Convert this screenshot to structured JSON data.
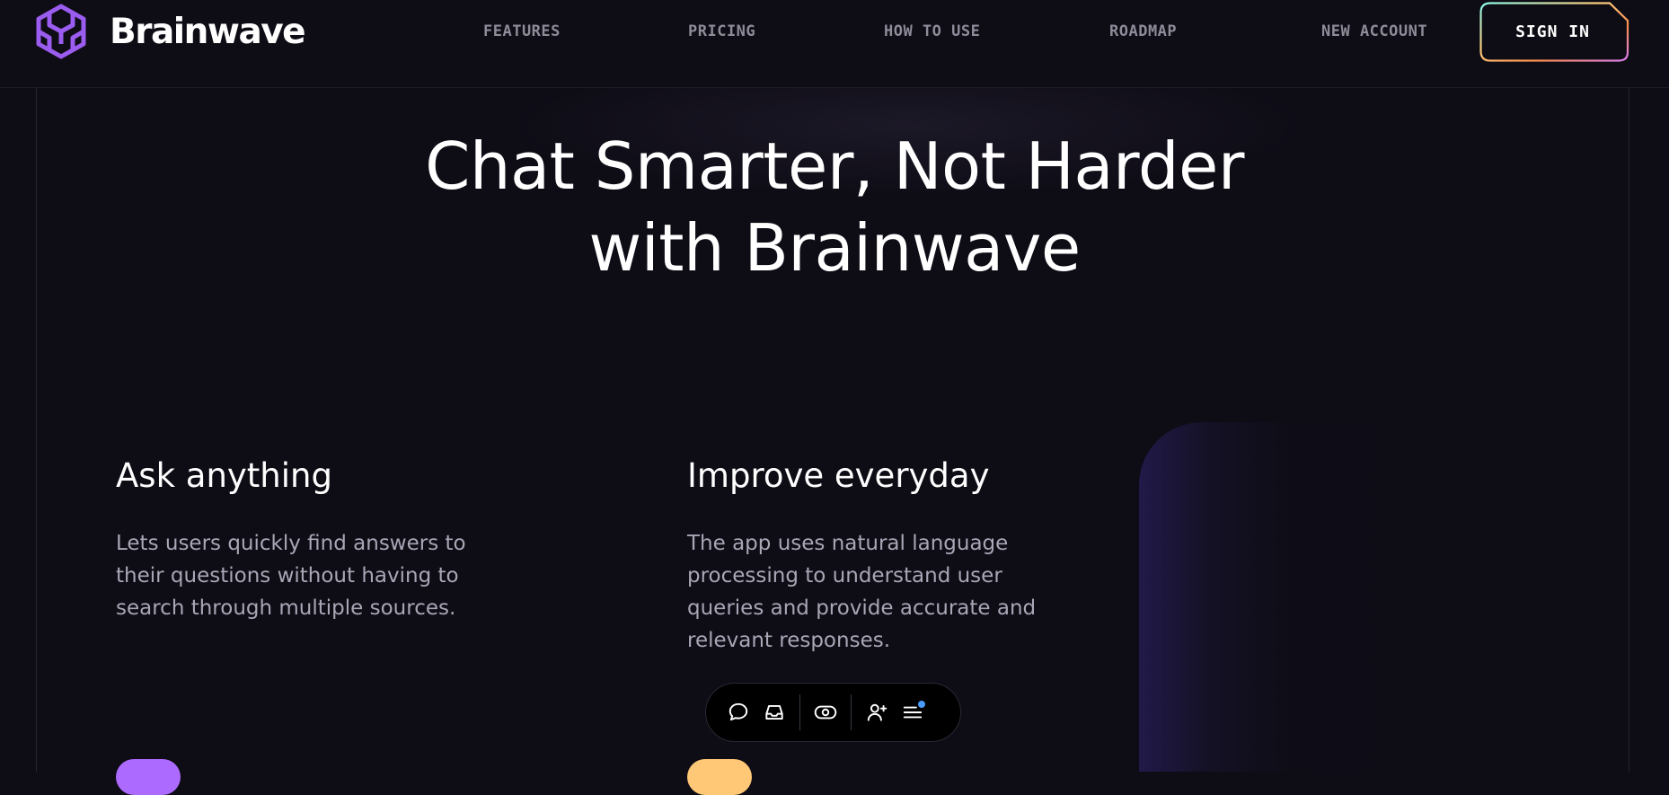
{
  "brand": {
    "name": "Brainwave",
    "logo_icon": "brainwave-logo-icon",
    "logo_colors": [
      "#a855f7",
      "#7c3aed"
    ]
  },
  "nav": {
    "items": [
      {
        "label": "FEATURES"
      },
      {
        "label": "PRICING"
      },
      {
        "label": "HOW TO USE"
      },
      {
        "label": "ROADMAP"
      },
      {
        "label": "NEW ACCOUNT"
      }
    ],
    "sign_in_label": "SIGN IN"
  },
  "hero": {
    "title_line1": "Chat Smarter, Not Harder",
    "title_line2": "with Brainwave"
  },
  "features": [
    {
      "title": "Ask anything",
      "lines": [
        "Lets users quickly find answers to",
        "their questions without having to",
        "search through multiple sources."
      ],
      "button_color": "#ac6aff"
    },
    {
      "title": "Improve everyday",
      "lines": [
        "The app uses natural language",
        "processing to understand user",
        "queries and provide accurate and",
        "relevant responses."
      ],
      "button_color": "#ffc876"
    }
  ],
  "toolbar": {
    "icons": [
      "chat-bubble-icon",
      "inbox-icon",
      "eye-toggle-icon",
      "add-user-icon",
      "menu-lines-icon"
    ],
    "notification_dot_color": "#4b9bff"
  },
  "colors": {
    "background": "#0e0c15",
    "nav_text": "#8f8c9a",
    "body_text": "#a9a6b6",
    "signin_gradient": [
      "#89f9e8",
      "#facb7b",
      "#fa8e4f",
      "#d87cee"
    ]
  }
}
